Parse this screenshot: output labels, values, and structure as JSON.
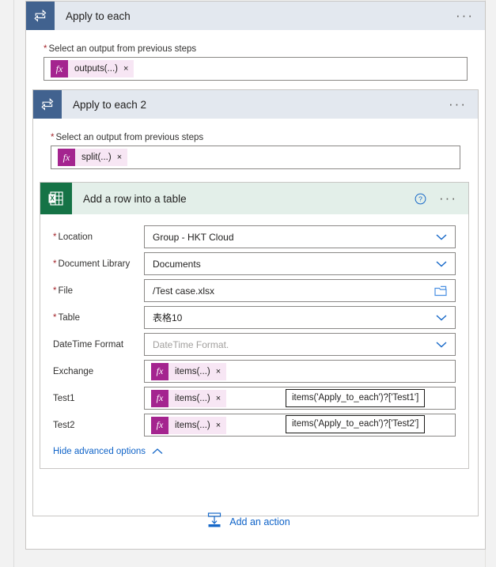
{
  "outer_loop": {
    "title": "Apply to each",
    "icon": "loop-icon",
    "menu": "···",
    "field": {
      "label": "Select an output from previous steps",
      "required_marker": "*",
      "token": "outputs(...)",
      "token_remove": "×",
      "fx": "fx"
    }
  },
  "inner_loop": {
    "title": "Apply to each 2",
    "icon": "loop-icon",
    "menu": "···",
    "field": {
      "label": "Select an output from previous steps",
      "required_marker": "*",
      "token": "split(...)",
      "token_remove": "×",
      "fx": "fx"
    }
  },
  "excel_action": {
    "title": "Add a row into a table",
    "icon": "excel-icon",
    "help": "?",
    "menu": "···",
    "fields": [
      {
        "label": "Location",
        "required": true,
        "value": "Group - HKT Cloud",
        "type": "dropdown"
      },
      {
        "label": "Document Library",
        "required": true,
        "value": "Documents",
        "type": "dropdown"
      },
      {
        "label": "File",
        "required": true,
        "value": "/Test case.xlsx",
        "type": "filepicker"
      },
      {
        "label": "Table",
        "required": true,
        "value": "表格10",
        "type": "dropdown"
      },
      {
        "label": "DateTime Format",
        "required": false,
        "value": "",
        "placeholder": "DateTime Format.",
        "type": "dropdown"
      },
      {
        "label": "Exchange",
        "required": false,
        "token": "items(...)",
        "type": "token"
      },
      {
        "label": "Test1",
        "required": false,
        "token": "items(...)",
        "type": "token",
        "tooltip": "items('Apply_to_each')?['Test1']"
      },
      {
        "label": "Test2",
        "required": false,
        "token": "items(...)",
        "type": "token",
        "tooltip": "items('Apply_to_each')?['Test2']"
      }
    ],
    "token_remove": "×",
    "fx": "fx",
    "advanced_link": "Hide advanced options"
  },
  "add_action": {
    "label": "Add an action",
    "icon": "insert-action-icon"
  },
  "colors": {
    "loop_tile": "#41628f",
    "loop_header": "#e3e8ef",
    "excel_tile": "#157346",
    "excel_header": "#e3efe9",
    "token_fx": "#a4248f",
    "token_body": "#f7e6f4",
    "link": "#0f63c8",
    "required": "#a4262c",
    "page_bg": "#f2f2f2"
  }
}
